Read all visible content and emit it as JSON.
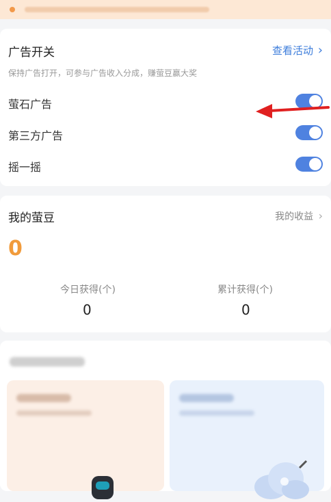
{
  "ad_switch": {
    "title": "广告开关",
    "view_activity": "查看活动",
    "view_activity_chevron": "›",
    "description": "保持广告打开，可参与广告收入分成，赚萤豆赢大奖",
    "toggles": [
      {
        "label": "萤石广告",
        "state": "on"
      },
      {
        "label": "第三方广告",
        "state": "on"
      },
      {
        "label": "摇一摇",
        "state": "on"
      }
    ]
  },
  "my_beans": {
    "title": "我的萤豆",
    "my_earnings": "我的收益",
    "earnings_chevron": "›",
    "balance": "0",
    "today_label": "今日获得(个)",
    "today_value": "0",
    "total_label": "累计获得(个)",
    "total_value": "0"
  },
  "colors": {
    "accent_blue": "#3d7ddb",
    "toggle_on": "#4f82e0",
    "orange": "#f19b3b",
    "arrow_red": "#e02020"
  }
}
